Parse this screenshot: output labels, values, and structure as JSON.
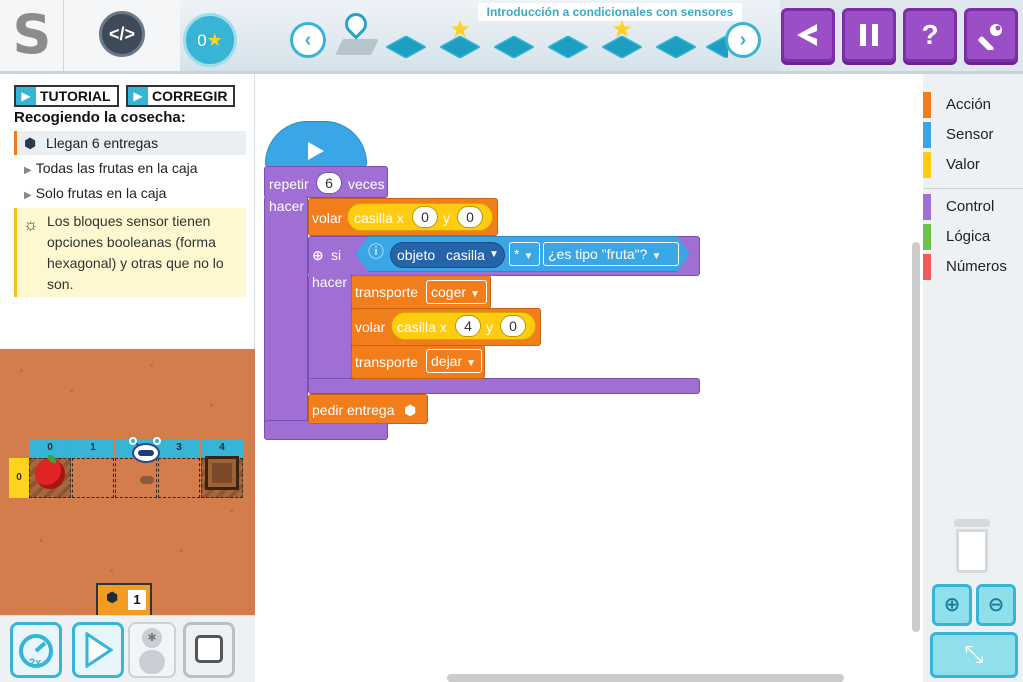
{
  "app": {
    "logo_letter": "S",
    "code_icon": "</>"
  },
  "header": {
    "stars_count": "0",
    "mission_title": "Introducción a condicionales con sensores",
    "prev_arrow": "‹",
    "next_arrow": "›",
    "buttons": {
      "back_icon": "back-arrow-icon",
      "pause_icon": "pause-icon",
      "help_icon": "question-icon",
      "settings_icon": "wrench-icon"
    }
  },
  "left": {
    "tutorial_label": "TUTORIAL",
    "corregir_label": "CORREGIR",
    "goal_title": "Recogiendo la cosecha:",
    "goals": [
      {
        "label": "Llegan 6 entregas",
        "active": true
      },
      {
        "label": "Todas las frutas en la caja",
        "active": false
      },
      {
        "label": "Solo frutas en la caja",
        "active": false
      }
    ],
    "hint": "Los bloques sensor tienen opciones booleanas (forma hexagonal) y otras que no lo son."
  },
  "stage": {
    "columns": [
      "0",
      "1",
      "2",
      "3",
      "4"
    ],
    "row": "0",
    "delivery_count": "1"
  },
  "program": {
    "repeat_label": "repetir",
    "repeat_count": "6",
    "repeat_suffix": "veces",
    "do_label": "hacer",
    "fly_label": "volar",
    "cell_label": "casilla x",
    "fly1_x": "0",
    "y_label": "y",
    "fly1_y": "0",
    "if_label": "si",
    "sensor_object": "objeto",
    "sensor_cell": "casilla",
    "sensor_any": "*",
    "sensor_type": "¿es tipo \"fruta\"?",
    "do_label2": "hacer",
    "transport_label": "transporte",
    "transport1_value": "coger",
    "fly2_x": "4",
    "fly2_y": "0",
    "transport2_value": "dejar",
    "request_label": "pedir entrega"
  },
  "palette": {
    "categories": [
      {
        "label": "Acción",
        "color": "#f27d1b"
      },
      {
        "label": "Sensor",
        "color": "#3ba6e6"
      },
      {
        "label": "Valor",
        "color": "#ffcc11"
      },
      {
        "label": "Control",
        "color": "#9f6fd4"
      },
      {
        "label": "Lógica",
        "color": "#6cc24a"
      },
      {
        "label": "Números",
        "color": "#f05a5a"
      }
    ]
  },
  "controls": {
    "speed_label": "2x"
  },
  "colors": {
    "accent": "#37b4d6",
    "toolbar_purple": "#9a4fc6",
    "action": "#f27d1b",
    "sensor": "#3ba6e6",
    "value": "#ffcc11",
    "control": "#9f6fd4"
  }
}
